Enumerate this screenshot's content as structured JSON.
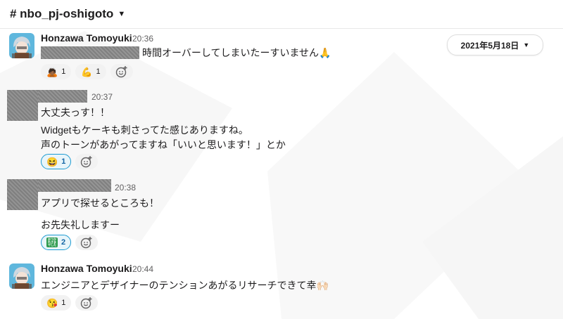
{
  "channel": {
    "name": "# nbo_pj-oshigoto",
    "chevron": "chevron-down-icon"
  },
  "date_divider": {
    "label": "2021年5月18日"
  },
  "messages": [
    {
      "author": "Honzawa Tomoyuki",
      "time": "20:36",
      "lines": [
        "時間オーバーしてしまいたーすいません🙏"
      ],
      "reactions": [
        {
          "emoji": "🙇🏾",
          "count": "1"
        },
        {
          "emoji": "💪",
          "count": "1"
        }
      ]
    },
    {
      "author": "",
      "time": "20:37",
      "lines": [
        "大丈夫っす！！",
        "Widgetもケーキも刺さってた感じありますね。",
        "声のトーンがあがってますね「いいと思います！」とか"
      ],
      "reactions": [
        {
          "emoji": "😆",
          "count": "1"
        }
      ]
    },
    {
      "author": "",
      "time": "20:38",
      "lines": [
        "アプリで探せるところも！",
        "お先失礼しますー"
      ],
      "reactions": [
        {
          "emoji": "おつかれさまでした",
          "count": "2"
        }
      ]
    },
    {
      "author": "Honzawa Tomoyuki",
      "time": "20:44",
      "lines": [
        "エンジニアとデザイナーのテンションあがるリサーチできて幸🙌🏻"
      ],
      "reactions": [
        {
          "emoji": "😘",
          "count": "1"
        }
      ]
    }
  ],
  "colors": {
    "accent": "#1d9bd1",
    "text": "#1d1c1d",
    "muted": "#616061"
  }
}
